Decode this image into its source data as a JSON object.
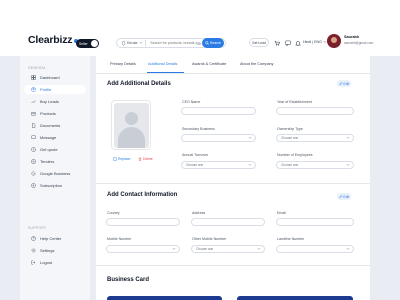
{
  "brand": {
    "name": "Clearbizz",
    "toggle_label": "Seller",
    "accent": "#2a7be4"
  },
  "header": {
    "location": "Kerala",
    "search_placeholder": "Search for products, brands and more",
    "search_button": "Search",
    "user_button": "Get Lead",
    "language": "Hindi | ENG",
    "user_name": "Saurabh",
    "user_email": "saurabh@gmail.com"
  },
  "sidebar": {
    "section_general": "GENERAL",
    "items": [
      {
        "label": "Dashboard",
        "icon": "grid-icon"
      },
      {
        "label": "Profile",
        "icon": "user-icon"
      },
      {
        "label": "Buy Leads",
        "icon": "trend-icon"
      },
      {
        "label": "Products",
        "icon": "box-icon"
      },
      {
        "label": "Documents",
        "icon": "document-icon"
      },
      {
        "label": "Message",
        "icon": "message-icon"
      },
      {
        "label": "Get quote",
        "icon": "quote-icon"
      },
      {
        "label": "Tenders",
        "icon": "tender-icon"
      },
      {
        "label": "Google Business",
        "icon": "google-icon"
      },
      {
        "label": "Subscription",
        "icon": "subscription-icon"
      }
    ],
    "section_support": "SUPPORT",
    "support_items": [
      {
        "label": "Help Center",
        "icon": "help-icon"
      },
      {
        "label": "Settings",
        "icon": "gear-icon"
      },
      {
        "label": "Logout",
        "icon": "logout-icon"
      }
    ]
  },
  "tabs": [
    {
      "label": "Primary Details"
    },
    {
      "label": "Additional Details"
    },
    {
      "label": "Awards & Certificate"
    },
    {
      "label": "About the Company"
    }
  ],
  "additional": {
    "title": "Add Additional Details",
    "edit": "Edit",
    "photo_replace": "Replace",
    "photo_delete": "Delete",
    "ceo_label": "CEO Name",
    "year_label": "Year of Establishment",
    "secondary_label": "Secondary Business",
    "ownership_label": "Ownership Type",
    "ownership_value": "Choose one",
    "turnover_label": "Annual Turnover",
    "turnover_value": "Choose one",
    "employees_label": "Number of Employees",
    "employees_value": "Choose one"
  },
  "contact": {
    "title": "Add Contact Information",
    "edit": "Edit",
    "country_label": "Country",
    "address_label": "Address",
    "email_label": "Email",
    "mobile_label": "Mobile Number",
    "other_mobile_label": "Other Mobile Number",
    "other_mobile_value": "Choose one",
    "landline_label": "Landline Number"
  },
  "business_card": {
    "title": "Business Card"
  }
}
